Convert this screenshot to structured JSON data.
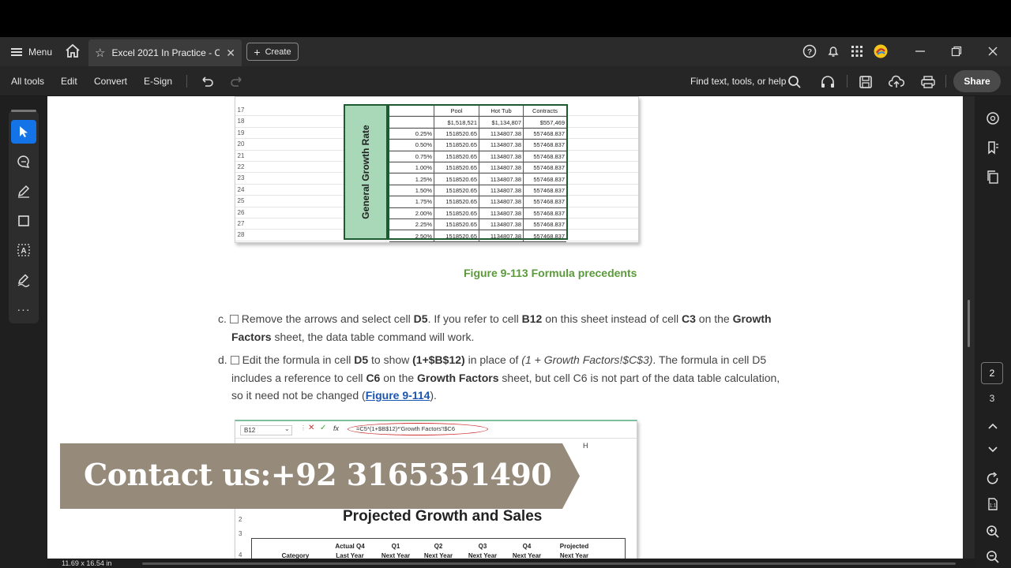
{
  "topbar": {
    "menu_label": "Menu",
    "tab_title": "Excel 2021 In Practice - C...",
    "create_label": "Create"
  },
  "toolbar": {
    "all_tools": "All tools",
    "edit": "Edit",
    "convert": "Convert",
    "esign": "E-Sign",
    "find_label": "Find text, tools, or help",
    "share_label": "Share"
  },
  "figure1": {
    "row_numbers": [
      "17",
      "18",
      "19",
      "20",
      "21",
      "22",
      "23",
      "24",
      "25",
      "26",
      "27",
      "28"
    ],
    "column_headers": [
      "",
      "Pool",
      "Hot Tub",
      "Contracts"
    ],
    "rotated_label": "General Growth Rate",
    "rows": [
      [
        "",
        "$1,518,521",
        "$1,134,807",
        "$557,469"
      ],
      [
        "0.25%",
        "1518520.65",
        "1134807.38",
        "557468.837"
      ],
      [
        "0.50%",
        "1518520.65",
        "1134807.38",
        "557468.837"
      ],
      [
        "0.75%",
        "1518520.65",
        "1134807.38",
        "557468.837"
      ],
      [
        "1.00%",
        "1518520.65",
        "1134807.38",
        "557468.837"
      ],
      [
        "1.25%",
        "1518520.65",
        "1134807.38",
        "557468.837"
      ],
      [
        "1.50%",
        "1518520.65",
        "1134807.38",
        "557468.837"
      ],
      [
        "1.75%",
        "1518520.65",
        "1134807.38",
        "557468.837"
      ],
      [
        "2.00%",
        "1518520.65",
        "1134807.38",
        "557468.837"
      ],
      [
        "2.25%",
        "1518520.65",
        "1134807.38",
        "557468.837"
      ],
      [
        "2.50%",
        "1518520.65",
        "1134807.38",
        "557468.837"
      ]
    ],
    "caption": "Figure 9-113 Formula precedents"
  },
  "steps": {
    "c_label": "c.",
    "c_t1": "Remove the arrows and select cell ",
    "c_b1": "D5",
    "c_t2": ". If you refer to cell ",
    "c_b2": "B12",
    "c_t3": " on this sheet instead of cell ",
    "c_b3": "C3",
    "c_t4": " on the ",
    "c_b4": "Growth",
    "c_b5": "Factors",
    "c_t5": " sheet, the data table command will work.",
    "d_label": "d.",
    "d_t1": "Edit the formula in cell ",
    "d_b1": "D5",
    "d_t2": " to show ",
    "d_b2": "(1+$B$12)",
    "d_t3": " in place of ",
    "d_i1": "(1 + Growth Factors!$C$3)",
    "d_t4": ". The formula in cell D5",
    "d_t5": "includes a reference to cell ",
    "d_b3": "C6",
    "d_t6": " on the ",
    "d_b4": "Growth Factors",
    "d_t7": " sheet, but cell C6 is not part of the data table calculation,",
    "d_t8": "so it need not be changed (",
    "d_link": "Figure 9-114",
    "d_t9": ")."
  },
  "figure2": {
    "namebox": "B12",
    "formula": "=C5*(1+$B$12)*'Growth Factors'!$C6",
    "col_h": "H",
    "title": "Projected Growth and Sales",
    "row2": "2",
    "row3": "3",
    "row4": "4",
    "headers": [
      "Category",
      "Actual Q4\nLast Year",
      "Q1\nNext Year",
      "Q2\nNext Year",
      "Q3\nNext Year",
      "Q4\nNext Year",
      "Projected\nNext Year"
    ]
  },
  "overlay": {
    "contact": "Contact us:+92 3165351490"
  },
  "right_panel": {
    "page_current": "2",
    "page_next": "3"
  },
  "status": {
    "page_size": "11.69 x 16.54 in"
  }
}
